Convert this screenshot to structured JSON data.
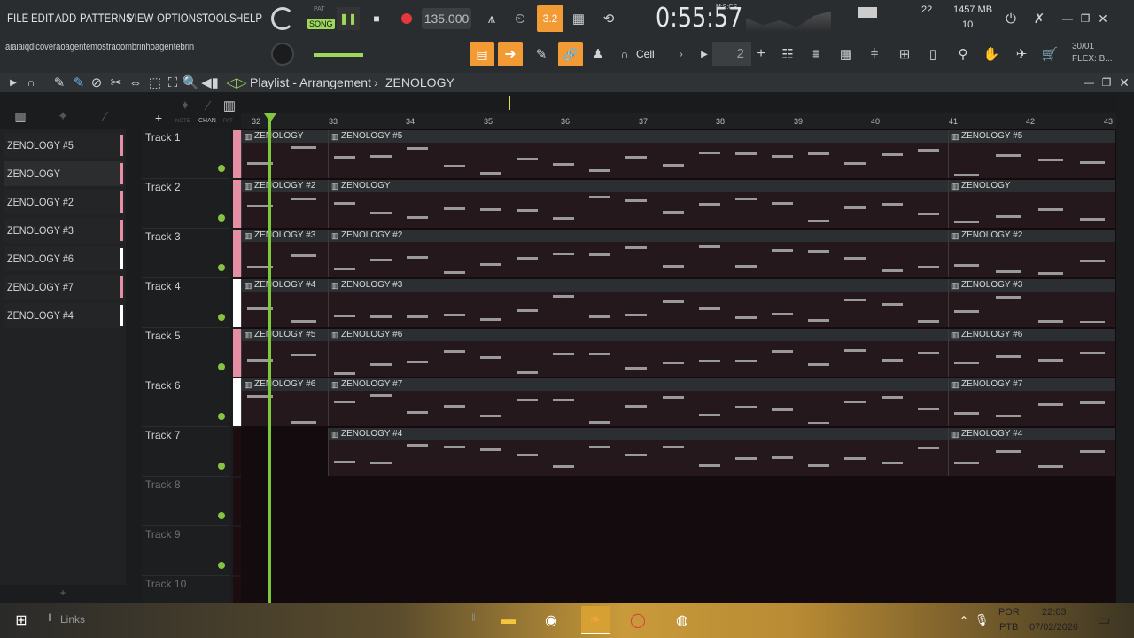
{
  "menu": [
    "FILE",
    "EDIT",
    "ADD",
    "PATTERNS",
    "VIEW",
    "OPTIONS",
    "TOOLS",
    "HELP"
  ],
  "transport": {
    "mode_pat": "PAT",
    "mode_song": "SONG",
    "tempo": "135.000",
    "time": "0:55:57",
    "time_label": "M:S:CS",
    "step": "3.2",
    "cpu": "22",
    "memory": "1457 MB",
    "voices": "10"
  },
  "hint_text": "aiaiaiqdlcoveraoagentemostraoombrinhoagentebrin",
  "toolbar2": {
    "snap": "Cell",
    "pattern_num": "2",
    "flex_label": "30/01",
    "flex_name": "FLEX: B..."
  },
  "playlist": {
    "title": "Playlist - Arrangement",
    "breadcrumb": "ZENOLOGY",
    "ruler_labels": [
      "NOTE",
      "CHAN",
      "PAT"
    ],
    "bars": [
      "32",
      "33",
      "34",
      "35",
      "36",
      "37",
      "38",
      "39",
      "40",
      "41",
      "42",
      "43"
    ]
  },
  "patterns": [
    {
      "name": "ZENOLOGY #5",
      "color": "#e58ea4"
    },
    {
      "name": "ZENOLOGY",
      "color": "#e58ea4"
    },
    {
      "name": "ZENOLOGY #2",
      "color": "#e58ea4"
    },
    {
      "name": "ZENOLOGY #3",
      "color": "#e58ea4"
    },
    {
      "name": "ZENOLOGY #6",
      "color": "#ffffff"
    },
    {
      "name": "ZENOLOGY #7",
      "color": "#e58ea4"
    },
    {
      "name": "ZENOLOGY #4",
      "color": "#ffffff"
    }
  ],
  "tracks": [
    "Track 1",
    "Track 2",
    "Track 3",
    "Track 4",
    "Track 5",
    "Track 6",
    "Track 7",
    "Track 8",
    "Track 9",
    "Track 10"
  ],
  "clips": [
    {
      "track": 0,
      "left": "ZENOLOGY",
      "mid": "ZENOLOGY #5",
      "right": "ZENOLOGY #5"
    },
    {
      "track": 1,
      "left": "ZENOLOGY #2",
      "mid": "ZENOLOGY",
      "right": "ZENOLOGY"
    },
    {
      "track": 2,
      "left": "ZENOLOGY #3",
      "mid": "ZENOLOGY #2",
      "right": "ZENOLOGY #2"
    },
    {
      "track": 3,
      "left": "ZENOLOGY #4",
      "mid": "ZENOLOGY #3",
      "right": "ZENOLOGY #3"
    },
    {
      "track": 4,
      "left": "ZENOLOGY #5",
      "mid": "ZENOLOGY #6",
      "right": "ZENOLOGY #6"
    },
    {
      "track": 5,
      "left": "ZENOLOGY #6",
      "mid": "ZENOLOGY #7",
      "right": "ZENOLOGY #7"
    },
    {
      "track": 6,
      "left": "",
      "mid": "ZENOLOGY #4",
      "right": "ZENOLOGY #4"
    }
  ],
  "taskbar": {
    "links": "Links",
    "lang1": "POR",
    "lang2": "PTB",
    "clock": "22:03",
    "date": "07/02/2026"
  }
}
